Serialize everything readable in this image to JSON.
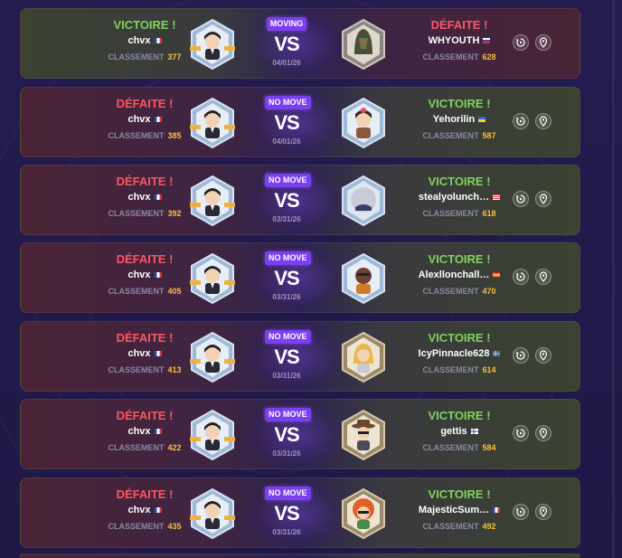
{
  "matches": [
    {
      "left_result": "VICTOIRE !",
      "left_player": "chvx",
      "left_rank": "377",
      "badge": "MOVING",
      "date": "04/01/26",
      "right_result": "DÉFAITE !",
      "right_player": "WHYOUTH",
      "right_rank": "628",
      "outcome": "win"
    },
    {
      "left_result": "DÉFAITE !",
      "left_player": "chvx",
      "left_rank": "385",
      "badge": "NO MOVE",
      "date": "04/01/26",
      "right_result": "VICTOIRE !",
      "right_player": "Yehorilin",
      "right_rank": "587",
      "outcome": "loss"
    },
    {
      "left_result": "DÉFAITE !",
      "left_player": "chvx",
      "left_rank": "392",
      "badge": "NO MOVE",
      "date": "03/31/26",
      "right_result": "VICTOIRE !",
      "right_player": "stealyolunch…",
      "right_rank": "618",
      "outcome": "loss"
    },
    {
      "left_result": "DÉFAITE !",
      "left_player": "chvx",
      "left_rank": "405",
      "badge": "NO MOVE",
      "date": "03/31/26",
      "right_result": "VICTOIRE !",
      "right_player": "Alexllonchall…",
      "right_rank": "470",
      "outcome": "loss"
    },
    {
      "left_result": "DÉFAITE !",
      "left_player": "chvx",
      "left_rank": "413",
      "badge": "NO MOVE",
      "date": "03/31/26",
      "right_result": "VICTOIRE !",
      "right_player": "IcyPinnacle628",
      "right_rank": "614",
      "outcome": "loss"
    },
    {
      "left_result": "DÉFAITE !",
      "left_player": "chvx",
      "left_rank": "422",
      "badge": "NO MOVE",
      "date": "03/31/26",
      "right_result": "VICTOIRE !",
      "right_player": "gettis",
      "right_rank": "584",
      "outcome": "loss"
    },
    {
      "left_result": "DÉFAITE !",
      "left_player": "chvx",
      "left_rank": "435",
      "badge": "NO MOVE",
      "date": "03/31/26",
      "right_result": "VICTOIRE !",
      "right_player": "MajesticSum…",
      "right_rank": "492",
      "outcome": "loss"
    }
  ],
  "labels": {
    "rank_label": "CLASSEMENT",
    "vs": "VS"
  },
  "colors": {
    "win": "#7ed35a",
    "loss": "#ff5560",
    "rank": "#f5c03a",
    "badge": "#7b3ff2"
  }
}
